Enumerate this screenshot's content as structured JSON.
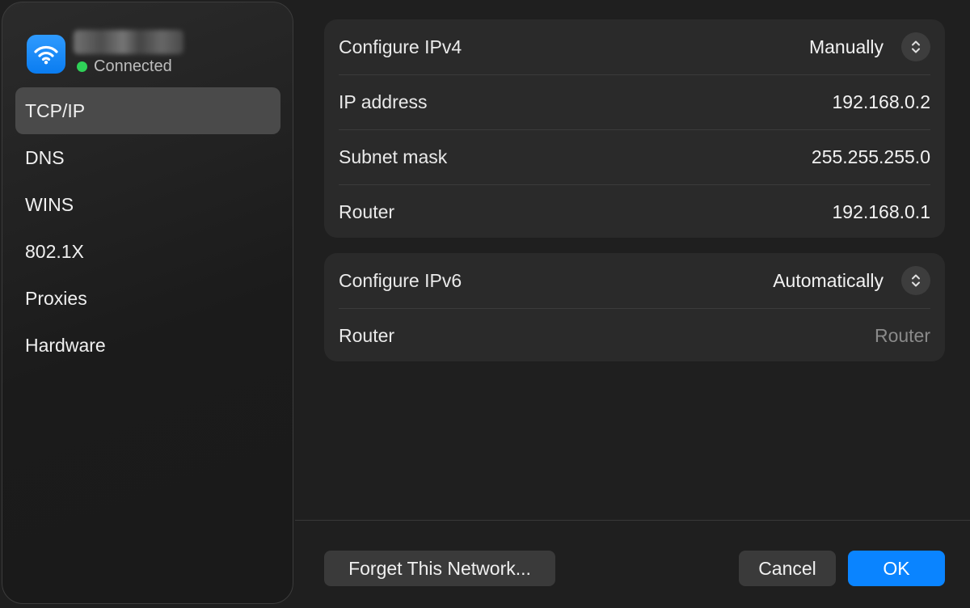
{
  "sidebar": {
    "network_status": "Connected",
    "status_color": "#2fd158",
    "icon": "wifi-icon",
    "items": [
      {
        "label": "TCP/IP",
        "active": true
      },
      {
        "label": "DNS"
      },
      {
        "label": "WINS"
      },
      {
        "label": "802.1X"
      },
      {
        "label": "Proxies"
      },
      {
        "label": "Hardware"
      }
    ]
  },
  "ipv4": {
    "configure_label": "Configure IPv4",
    "configure_value": "Manually",
    "ip_label": "IP address",
    "ip_value": "192.168.0.2",
    "subnet_label": "Subnet mask",
    "subnet_value": "255.255.255.0",
    "router_label": "Router",
    "router_value": "192.168.0.1"
  },
  "ipv6": {
    "configure_label": "Configure IPv6",
    "configure_value": "Automatically",
    "router_label": "Router",
    "router_placeholder": "Router"
  },
  "footer": {
    "forget_label": "Forget This Network...",
    "cancel_label": "Cancel",
    "ok_label": "OK"
  },
  "colors": {
    "accent": "#0a84ff"
  }
}
